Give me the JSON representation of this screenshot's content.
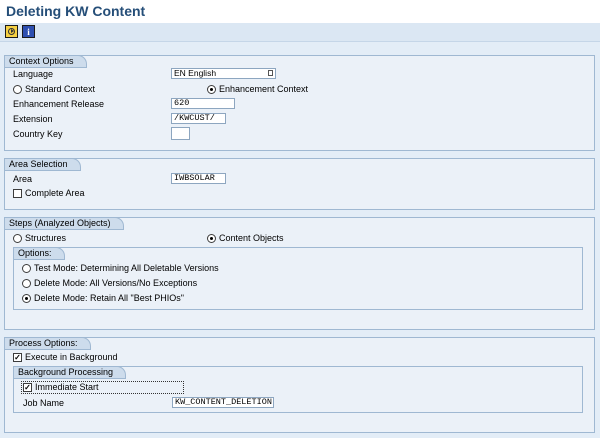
{
  "window": {
    "title": "Deleting KW Content"
  },
  "toolbar": {
    "execute_icon": "execute-icon",
    "info_icon_glyph": "i"
  },
  "context_options": {
    "title": "Context Options",
    "language_label": "Language",
    "language_value": "EN English",
    "standard_context_label": "Standard Context",
    "enhancement_context_label": "Enhancement Context",
    "enhancement_release_label": "Enhancement Release",
    "enhancement_release_value": "620",
    "extension_label": "Extension",
    "extension_value": "/KWCUST/",
    "country_key_label": "Country Key",
    "country_key_value": ""
  },
  "area_selection": {
    "title": "Area Selection",
    "area_label": "Area",
    "area_value": "IWBSOLAR",
    "complete_area_label": "Complete Area"
  },
  "steps": {
    "title": "Steps (Analyzed Objects)",
    "structures_label": "Structures",
    "content_objects_label": "Content Objects",
    "options": {
      "title": "Options:",
      "test_mode_label": "Test Mode: Determining All Deletable Versions",
      "delete_all_label": "Delete Mode: All Versions/No Exceptions",
      "delete_retain_label": "Delete Mode: Retain All \"Best PHIOs\""
    }
  },
  "process_options": {
    "title": "Process Options:",
    "execute_background_label": "Execute in Background",
    "background_processing": {
      "title": "Background Processing",
      "immediate_start_label": "Immediate Start",
      "job_name_label": "Job Name",
      "job_name_value": "KW_CONTENT_DELETION"
    }
  },
  "state": {
    "context": "enhancement",
    "steps": "content_objects",
    "mode": "delete_retain",
    "complete_area": false,
    "execute_background": true,
    "immediate_start": true
  }
}
